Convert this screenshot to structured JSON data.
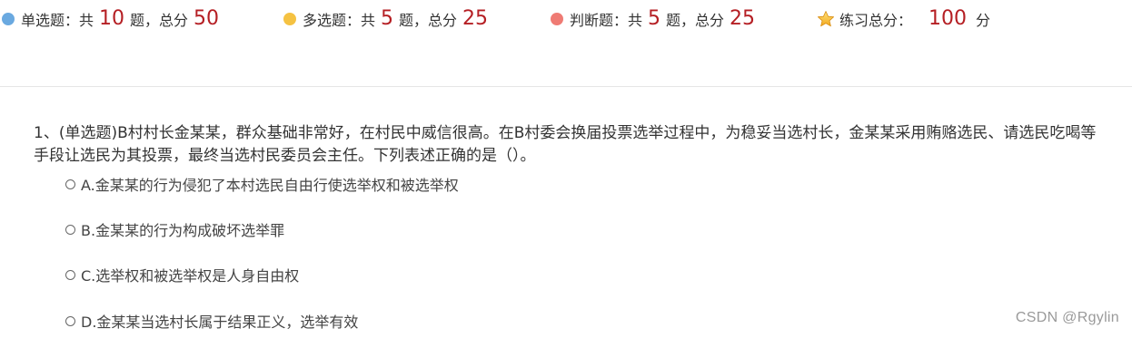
{
  "summary": {
    "colors": {
      "single_dot": "#6aa9e0",
      "multi_dot": "#f5c242",
      "judge_dot": "#ef7b74",
      "number": "#b51f24"
    },
    "single": {
      "label": "单选题：共",
      "count": "10",
      "mid": "题，总分",
      "score": "50"
    },
    "multi": {
      "label": "多选题：共",
      "count": "5",
      "mid": "题，总分",
      "score": "25"
    },
    "judge": {
      "label": "判断题：共",
      "count": "5",
      "mid": "题，总分",
      "score": "25"
    },
    "total": {
      "icon": "star-icon",
      "label": "练习总分：",
      "score": "100",
      "unit": "分"
    }
  },
  "question": {
    "text": "1、(单选题)B村村长金某某，群众基础非常好，在村民中威信很高。在B村委会换届投票选举过程中，为稳妥当选村长，金某某采用贿赂选民、请选民吃喝等手段让选民为其投票，最终当选村民委员会主任。下列表述正确的是（）。",
    "options": [
      {
        "label": "A.金某某的行为侵犯了本村选民自由行使选举权和被选举权"
      },
      {
        "label": "B.金某某的行为构成破坏选举罪"
      },
      {
        "label": "C.选举权和被选举权是人身自由权"
      },
      {
        "label": "D.金某某当选村长属于结果正义，选举有效"
      }
    ]
  },
  "watermark": "CSDN @Rgylin"
}
